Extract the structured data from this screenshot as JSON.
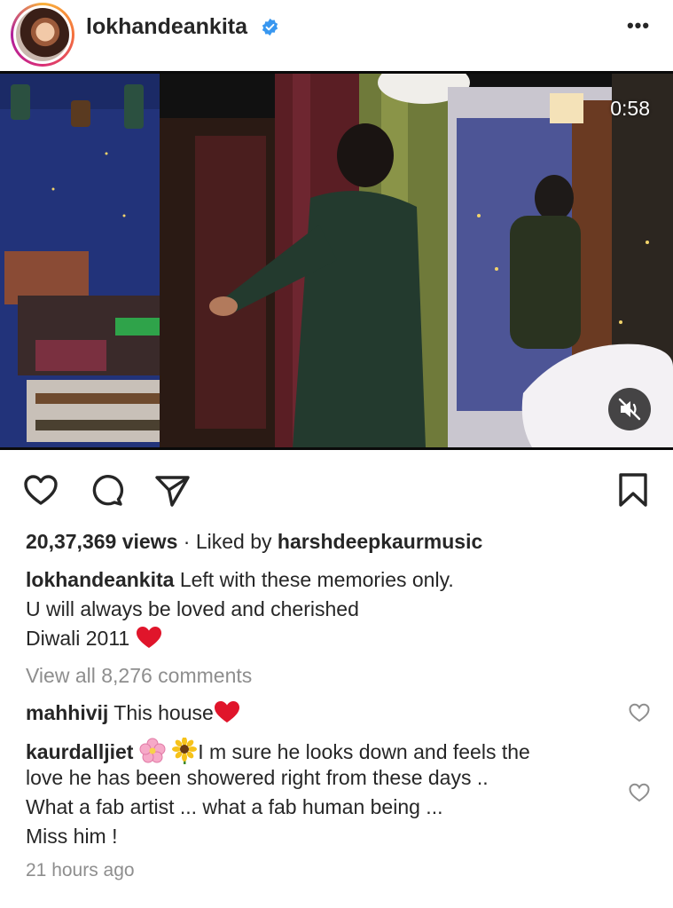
{
  "post": {
    "username": "lokhandeankita",
    "verified_icon": "verified-badge-icon",
    "more_label": "•••",
    "video_timer": "0:58",
    "views": "20,37,369 views",
    "liked_by_prefix": "Liked by",
    "liked_by_user": "harshdeepkaurmusic",
    "caption_lines": [
      "Left with these memories only.",
      "U will always be loved and cherished",
      "Diwali 2011"
    ],
    "view_comments": "View all 8,276 comments",
    "time_ago": "21 hours ago"
  },
  "comments": [
    {
      "user": "mahhivij",
      "text": "This house"
    },
    {
      "user": "kaurdalljiet",
      "lines": [
        "I m sure he looks down and feels the",
        "love he has been showered right from these days ..",
        "What a fab artist ... what a fab human being ...",
        "Miss him !"
      ]
    }
  ],
  "colors": {
    "verified": "#3897f0",
    "heart_red": "#e0152b",
    "muted_text": "#8e8e8e",
    "wall_blue": "#22337a"
  }
}
